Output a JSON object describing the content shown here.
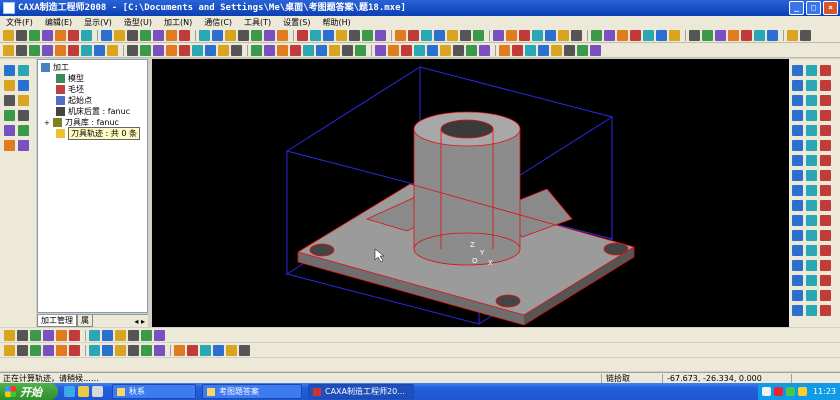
{
  "window": {
    "title": "CAXA制造工程师2008  - [C:\\Documents and Settings\\Me\\桌面\\考图题答案\\题18.mxe]",
    "controls": [
      "_",
      "□",
      "×"
    ]
  },
  "menu": [
    "文件(F)",
    "编辑(E)",
    "显示(V)",
    "造型(U)",
    "加工(N)",
    "通信(C)",
    "工具(T)",
    "设置(S)",
    "帮助(H)"
  ],
  "tree": {
    "root": "加工",
    "items": [
      {
        "label": "模型"
      },
      {
        "label": "毛坯"
      },
      {
        "label": "起始点"
      },
      {
        "label": "机床后置 : fanuc"
      },
      {
        "label": "刀具库 : fanuc"
      },
      {
        "label": "刀具轨迹 : 共 0 条"
      }
    ],
    "tabs": [
      "加工管理",
      "属"
    ]
  },
  "viewport": {
    "axis_labels": [
      "Z",
      "Y",
      "O",
      "X"
    ]
  },
  "status": {
    "message": "正在计算轨迹，请稍候……",
    "mode": "链拾取",
    "coordinates": "-67.673, -26.334, 0.000"
  },
  "taskbar": {
    "start_label": "开始",
    "buttons": [
      "秋系",
      "考图题答案",
      "CAXA制造工程师20..."
    ],
    "clock": "11:23"
  },
  "colors": {
    "titlebar": "#0b3fb4",
    "viewport_background": "#000000",
    "part_gray": "#9a9a9a",
    "blank_box": "#2a2ae0",
    "edge_red": "#e01010",
    "taskbar": "#245edb"
  }
}
